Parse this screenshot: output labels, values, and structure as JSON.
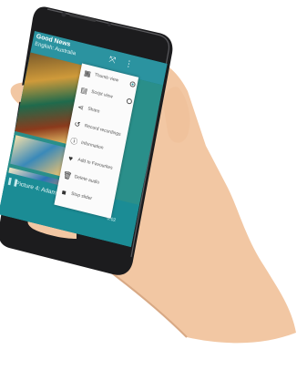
{
  "app": {
    "title": "Good News",
    "subtitle": "English: Australia"
  },
  "menu": {
    "items": [
      {
        "label": "Thumb view",
        "icon": "thumbnail-icon",
        "selected": true
      },
      {
        "label": "Script view",
        "icon": "script-icon",
        "selected": false
      },
      {
        "label": "Share",
        "icon": "share-icon"
      },
      {
        "label": "Record recordings",
        "icon": "history-icon"
      },
      {
        "label": "Information",
        "icon": "info-icon"
      },
      {
        "label": "Add to Favourites",
        "icon": "favourite-icon"
      },
      {
        "label": "Delete audio",
        "icon": "delete-icon"
      },
      {
        "label": "Stop slider",
        "icon": "stop-icon"
      }
    ]
  },
  "player": {
    "track_title": "Picture 4: Adam and Eve",
    "time": "0:02"
  },
  "colors": {
    "appbar": "#2b93a0",
    "player": "#1b8c95",
    "menu_bg": "#fbfbfb"
  }
}
